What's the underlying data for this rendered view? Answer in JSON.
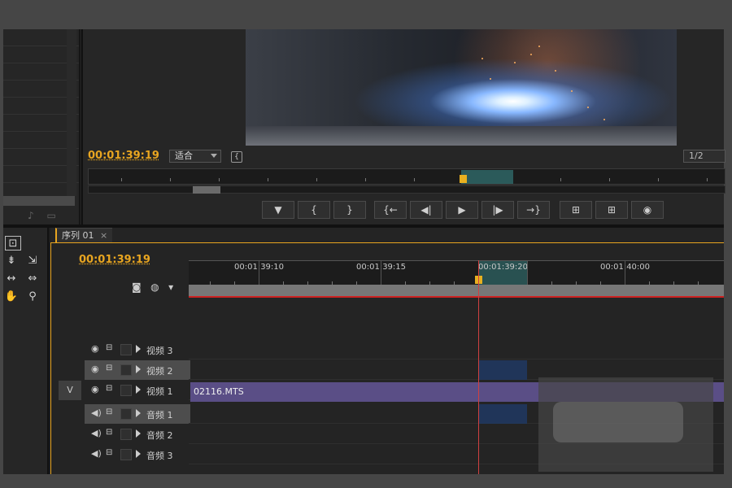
{
  "monitor": {
    "timecode": "00:01:39:19",
    "fit_label": "适合",
    "resolution_label": "1/2",
    "transport": [
      "▼",
      "{",
      "}",
      "{←",
      "◀|",
      "▶",
      "|▶",
      "→}",
      "⊞",
      "⊞",
      "📷"
    ]
  },
  "sequence": {
    "tab_label": "序列 01",
    "tab_close": "×",
    "timecode": "00:01:39:19",
    "ruler_labels": [
      "00:01:39:10",
      "00:01:39:15",
      "00:01:39:20",
      "00:01:40:00"
    ],
    "tracks": [
      {
        "name": "视频 3",
        "type": "video",
        "target": ""
      },
      {
        "name": "视频 2",
        "type": "video",
        "target": ""
      },
      {
        "name": "视频 1",
        "type": "video",
        "target": "V"
      },
      {
        "name": "音频 1",
        "type": "audio",
        "target": ""
      },
      {
        "name": "音频 2",
        "type": "audio",
        "target": ""
      },
      {
        "name": "音频 3",
        "type": "audio",
        "target": ""
      }
    ],
    "clip_name": "02116.MTS"
  },
  "colors": {
    "accent": "#e8a520",
    "clip_video": "#5a4e86",
    "playhead": "#d04040"
  },
  "icons": [
    "eye-icon",
    "sync-lock-icon",
    "speaker-icon",
    "expand-triangle-icon",
    "hand-tool-icon",
    "zoom-tool-icon",
    "camera-icon"
  ]
}
